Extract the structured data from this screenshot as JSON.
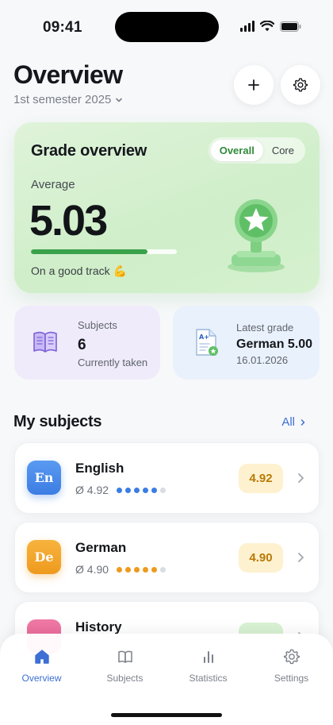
{
  "status_bar": {
    "time": "09:41"
  },
  "header": {
    "title": "Overview",
    "semester": "1st semester 2025"
  },
  "grade_overview": {
    "title": "Grade overview",
    "tabs": [
      {
        "label": "Overall",
        "active": true
      },
      {
        "label": "Core",
        "active": false
      }
    ],
    "average_label": "Average",
    "average_value": "5.03",
    "progress_fraction": 0.8,
    "track_text": "On a good track 💪"
  },
  "subjects_summary": {
    "label": "Subjects",
    "count": "6",
    "caption": "Currently taken"
  },
  "latest_grade": {
    "label": "Latest grade",
    "value": "German 5.00",
    "date": "16.01.2026"
  },
  "my_subjects": {
    "title": "My subjects",
    "all_label": "All",
    "items": [
      {
        "abbr": "En",
        "name": "English",
        "average": "Ø 4.92",
        "grade": "4.92",
        "filled_dots": 5,
        "accent": "#3b7de3",
        "pill_bg": "#fdf1cf",
        "pill_color": "#b97a08"
      },
      {
        "abbr": "De",
        "name": "German",
        "average": "Ø 4.90",
        "grade": "4.90",
        "filled_dots": 5,
        "accent": "#ee9a1d",
        "pill_bg": "#fdf1cf",
        "pill_color": "#b97a08"
      },
      {
        "abbr": "",
        "name": "History",
        "average": "",
        "grade": "",
        "filled_dots": 0,
        "accent": "#e85b8f",
        "pill_bg": "#d9f2d3",
        "pill_color": "#2f8a3a"
      }
    ]
  },
  "tab_bar": {
    "items": [
      {
        "label": "Overview",
        "icon": "home-icon",
        "active": true
      },
      {
        "label": "Subjects",
        "icon": "book-icon",
        "active": false
      },
      {
        "label": "Statistics",
        "icon": "bar-chart-icon",
        "active": false
      },
      {
        "label": "Settings",
        "icon": "gear-icon",
        "active": false
      }
    ]
  },
  "colors": {
    "accent": "#3d6fd4",
    "success": "#3aa24a",
    "grade_card_bg": "#d6f1cf"
  }
}
